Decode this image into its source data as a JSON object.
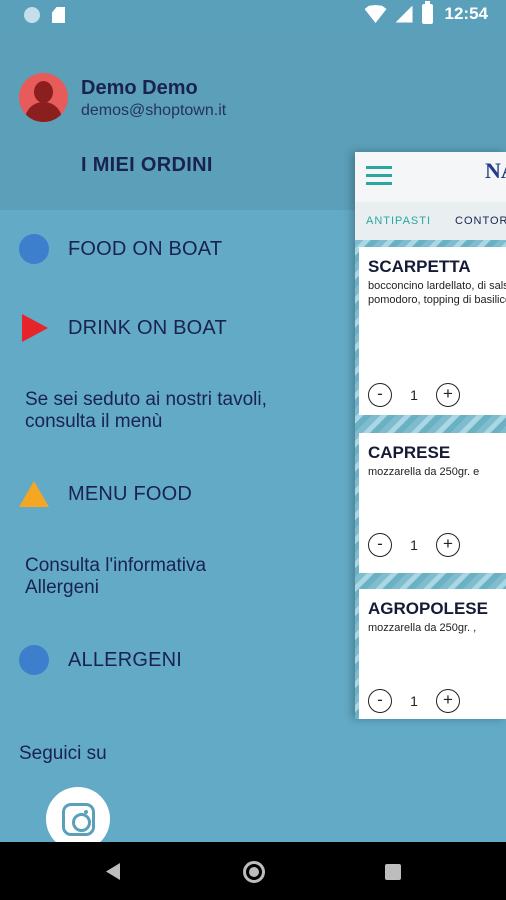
{
  "status_bar": {
    "time": "12:54"
  },
  "drawer": {
    "user": {
      "name": "Demo Demo",
      "email": "demos@shoptown.it"
    },
    "orders_label": "I MIEI ORDINI",
    "menu": {
      "food_on_boat": {
        "label": "FOOD ON BOAT",
        "icon": "blue-circle-icon",
        "color": "#3d7fcc"
      },
      "drink_on_boat": {
        "label": "DRINK ON BOAT",
        "icon": "red-play-icon",
        "color": "#e8242b"
      },
      "info_menu": "Se sei seduto ai nostri tavoli, consulta il menù",
      "menu_food": {
        "label": "MENU FOOD",
        "icon": "orange-triangle-icon",
        "color": "#f5a623"
      },
      "info_allergens": "Consulta l'informativa Allergeni",
      "allergeni": {
        "label": "ALLERGENI",
        "icon": "blue-circle-icon",
        "color": "#3d7fcc"
      }
    },
    "follow_label": "Seguici su",
    "social": {
      "icon": "instagram-icon"
    }
  },
  "app_preview": {
    "logo_text": "NA",
    "tabs": [
      "ANTIPASTI",
      "CONTOR"
    ],
    "products": [
      {
        "name": "SCARPETTA",
        "description": "bocconcino lardellato, di salsa di pomodoro, topping di basilico e p",
        "quantity": "1"
      },
      {
        "name": "CAPRESE",
        "description": "mozzarella da 250gr. e",
        "quantity": "1"
      },
      {
        "name": "AGROPOLESE",
        "description": "mozzarella da 250gr. ,",
        "quantity": "1"
      }
    ],
    "qty_minus": "-",
    "qty_plus": "+"
  },
  "colors": {
    "drawer_bg": "#62aac6",
    "header_bg": "#5b9fb8",
    "accent": "#2aa6a0",
    "text": "#1a2350"
  }
}
